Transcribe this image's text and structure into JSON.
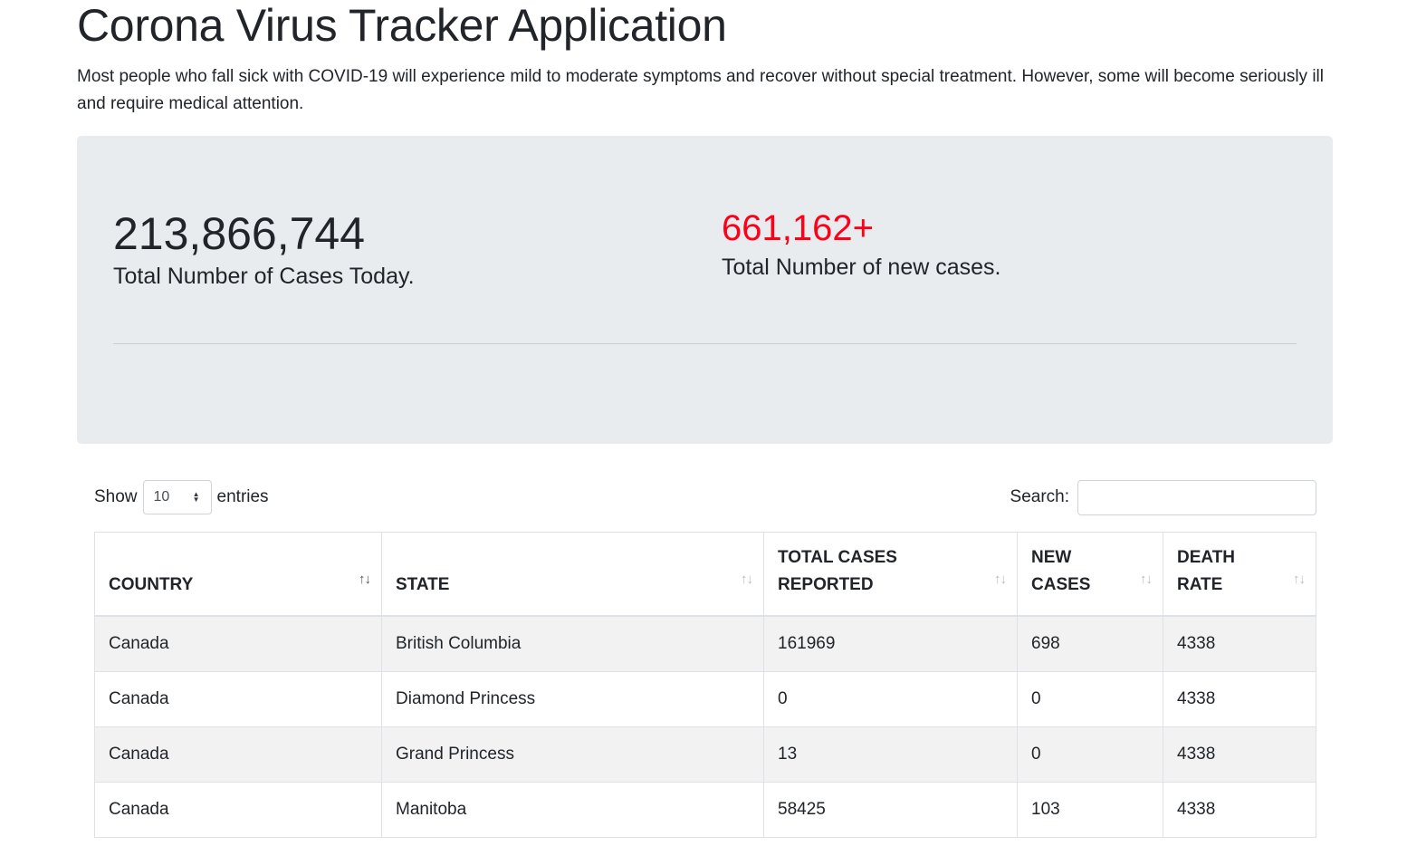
{
  "page": {
    "title": "Corona Virus Tracker Application",
    "description": "Most people who fall sick with COVID-19 will experience mild to moderate symptoms and recover without special treatment. However, some will become seriously ill and require medical attention."
  },
  "stats": {
    "total_cases": "213,866,744",
    "total_cases_label": "Total Number of Cases Today.",
    "new_cases": "661,162+",
    "new_cases_label": "Total Number of new cases.",
    "new_cases_color": "#ff0019"
  },
  "table_controls": {
    "show_label": "Show",
    "entries_value": "10",
    "entries_label": "entries",
    "search_label": "Search:",
    "search_value": ""
  },
  "table": {
    "columns": [
      {
        "label": "Country",
        "sort_icon": "sort-arrows-icon"
      },
      {
        "label": "State",
        "sort_icon": "sort-arrows-icon"
      },
      {
        "label": "Total Cases Reported",
        "sort_icon": "sort-arrows-icon"
      },
      {
        "label": "New Cases",
        "sort_icon": "sort-arrows-icon"
      },
      {
        "label": "Death Rate",
        "sort_icon": "sort-arrows-icon"
      }
    ],
    "sort_glyph": "↑↓",
    "rows": [
      {
        "country": "Canada",
        "state": "British Columbia",
        "total": "161969",
        "new": "698",
        "death_rate": "4338"
      },
      {
        "country": "Canada",
        "state": "Diamond Princess",
        "total": "0",
        "new": "0",
        "death_rate": "4338"
      },
      {
        "country": "Canada",
        "state": "Grand Princess",
        "total": "13",
        "new": "0",
        "death_rate": "4338"
      },
      {
        "country": "Canada",
        "state": "Manitoba",
        "total": "58425",
        "new": "103",
        "death_rate": "4338"
      }
    ]
  }
}
